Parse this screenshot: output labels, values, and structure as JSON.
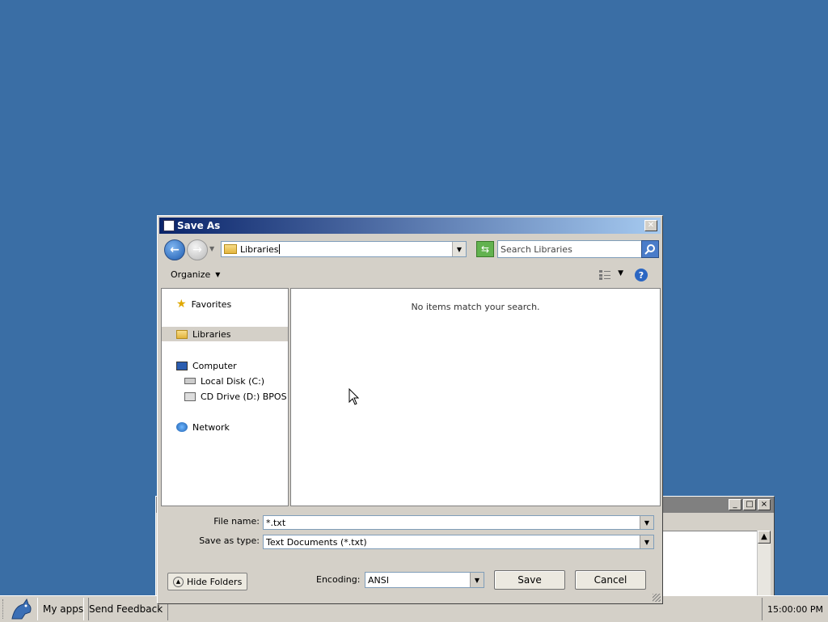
{
  "background_window": {
    "controls": [
      "_",
      "□",
      "×"
    ]
  },
  "taskbar": {
    "my_apps": "My apps",
    "send_feedback": "Send Feedback",
    "clock": "15:00:00 PM"
  },
  "dialog": {
    "title": "Save As",
    "address": "Libraries",
    "search_placeholder": "Search Libraries",
    "organize_label": "Organize",
    "nav": {
      "favorites": "Favorites",
      "libraries": "Libraries",
      "computer": "Computer",
      "local_disk": "Local Disk (C:)",
      "cd_drive": "CD Drive (D:) BPOS",
      "network": "Network"
    },
    "empty_message": "No items match your search.",
    "file_name_label": "File name:",
    "file_name_value": "*.txt",
    "save_type_label": "Save as type:",
    "save_type_value": "Text Documents (*.txt)",
    "hide_folders": "Hide Folders",
    "encoding_label": "Encoding:",
    "encoding_value": "ANSI",
    "save_button": "Save",
    "cancel_button": "Cancel"
  },
  "colors": {
    "desktop": "#3a6ea5",
    "title_start": "#0a246a",
    "title_end": "#a6caf0",
    "selection": "#d4d0c8"
  }
}
